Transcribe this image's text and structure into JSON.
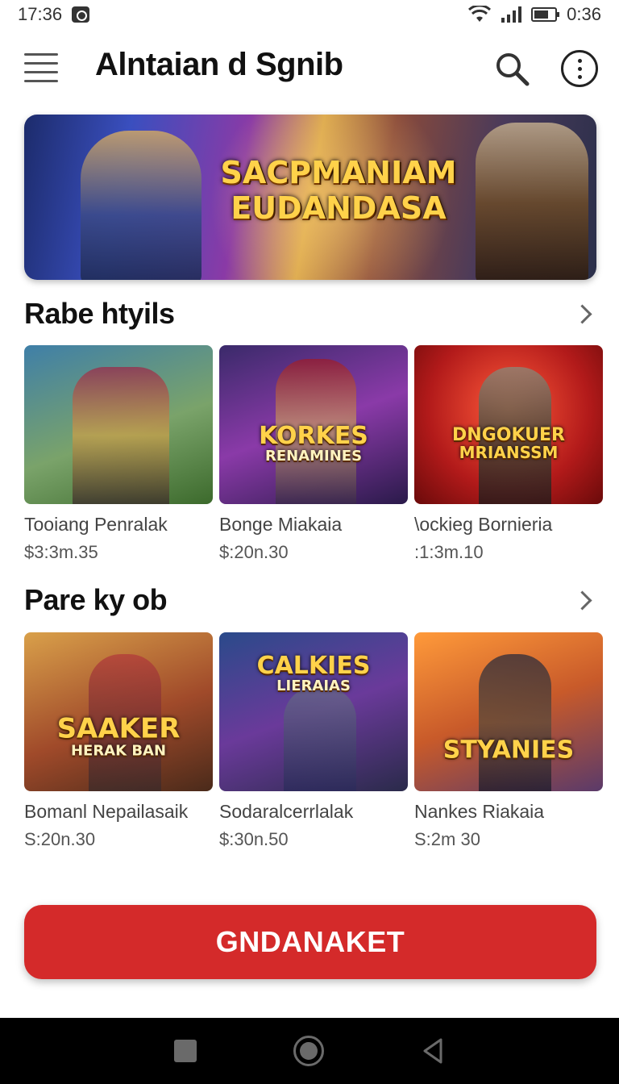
{
  "status_bar": {
    "time_left": "17:36",
    "time_right": "0:36"
  },
  "app_bar": {
    "title": "Alntaian d Sgnib",
    "icons": [
      "menu-icon",
      "search-icon",
      "more-vert-icon"
    ]
  },
  "hero": {
    "title_line1": "SACPMANIAM",
    "title_line2": "EUDANDASA"
  },
  "sections": [
    {
      "title": "Rabe htyils",
      "cards": [
        {
          "art_big": "",
          "art_small": "",
          "name": "Tooiang Penralak",
          "price": "$3:3m.35"
        },
        {
          "art_big": "KORKES",
          "art_small": "RENAMINES",
          "name": "Bonge Miakaia",
          "price": "$:20n.30"
        },
        {
          "art_big": "DNGOKUER",
          "art_small": "MRIANSSM",
          "name": "\\ockieg Bornieria",
          "price": ":1:3m.10"
        }
      ]
    },
    {
      "title": "Pare ky ob",
      "cards": [
        {
          "art_big": "SAAKER",
          "art_small": "HERAK BAN",
          "name": "Bomanl Nepailasaik",
          "price": "S:20n.30"
        },
        {
          "art_big": "CALKIES",
          "art_small": "LIERAIAS",
          "name": "Sodaralcerrlalak",
          "price": "$:30n.50"
        },
        {
          "art_big": "STYANIES",
          "art_small": "",
          "name": "Nankes Riakaia",
          "price": "S:2m 30"
        }
      ]
    }
  ],
  "cta": {
    "label": "GNDANAKET"
  },
  "nav_bar": {
    "icons": [
      "recents-icon",
      "home-icon",
      "back-icon"
    ]
  },
  "colors": {
    "accent": "#d42a2a",
    "nav_bg": "#000000",
    "title_gold": "#ffd24a"
  }
}
